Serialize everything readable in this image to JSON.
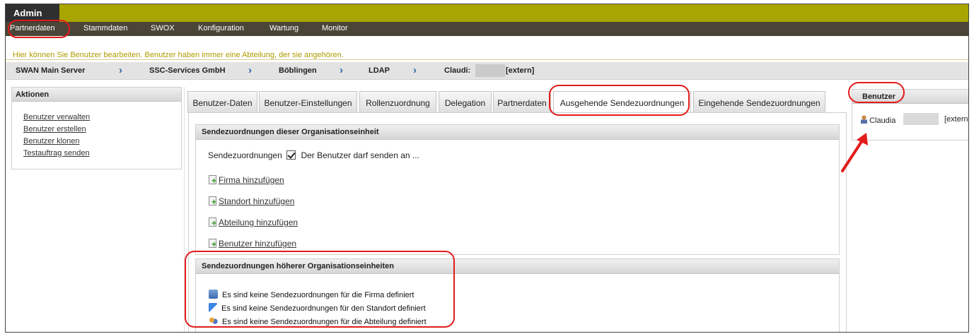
{
  "app": {
    "title": "Admin"
  },
  "menu": [
    "Partnerdaten",
    "Stammdaten",
    "SWOX",
    "Konfiguration",
    "Wartung",
    "Monitor"
  ],
  "info_text": "Hier können Sie Benutzer bearbeiten. Benutzer haben immer eine Abteilung, der sie angehören.",
  "breadcrumb": {
    "items": [
      "SWAN Main Server",
      "SSC-Services GmbH",
      "Böblingen",
      "LDAP",
      "Claudi:"
    ],
    "suffix": "[extern]"
  },
  "actions": {
    "title": "Aktionen",
    "links": [
      "Benutzer verwalten",
      "Benutzer erstellen",
      "Benutzer klonen",
      "Testauftrag senden"
    ]
  },
  "tabs": [
    "Benutzer-Daten",
    "Benutzer-Einstellungen",
    "Rollenzuordnung",
    "Delegation",
    "Partnerdaten",
    "Ausgehende Sendezuordnungen",
    "Eingehende Sendezuordnungen"
  ],
  "active_tab": "Ausgehende Sendezuordnungen",
  "section1": {
    "title": "Sendezuordnungen dieser Organisationseinheit",
    "send_label": "Sendezuordnungen",
    "send_checkbox_label": "Der Benutzer darf senden an ...",
    "add_links": [
      "Firma hinzufügen",
      "Standort hinzufügen",
      "Abteilung hinzufügen",
      "Benutzer hinzufügen"
    ]
  },
  "section2": {
    "title": "Sendezuordnungen höherer Organisationseinheiten",
    "rows": [
      "Es sind keine Sendezuordnungen für die Firma definiert",
      "Es sind keine Sendezuordnungen für den Standort definiert",
      "Es sind keine Sendezuordnungen für die Abteilung definiert"
    ]
  },
  "user_panel": {
    "title": "Benutzer",
    "name": "Claudia",
    "suffix": "[extern]"
  },
  "colors": {
    "brand_bar": "#a8a400",
    "menubar": "#4b4538",
    "info_text": "#b09a00",
    "highlight": "#e21b1b",
    "crumb_arrow": "#2a62a6"
  },
  "icons": [
    "plus-document-icon",
    "company-icon",
    "flag-icon",
    "department-icon",
    "user-icon",
    "chevron-right-icon",
    "arrow-icon"
  ]
}
